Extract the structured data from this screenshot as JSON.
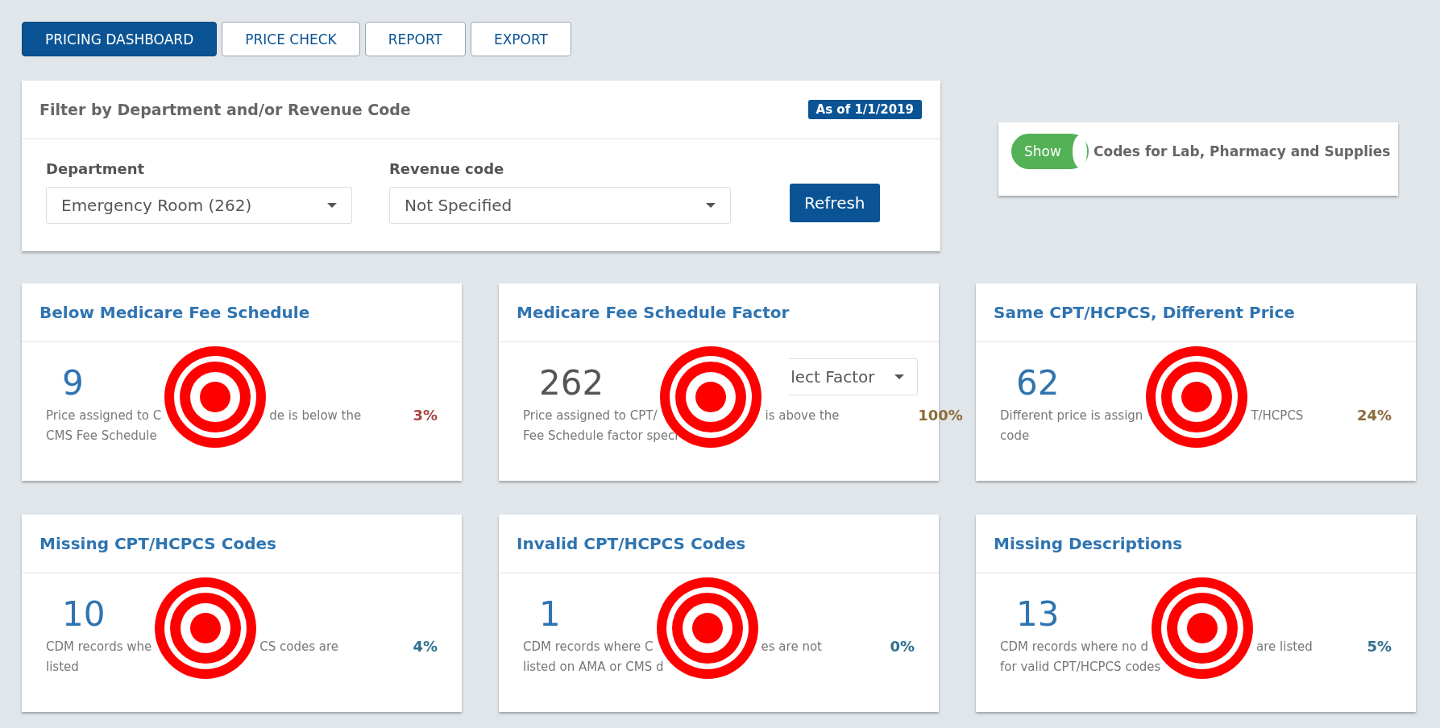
{
  "tabs": [
    {
      "label": "PRICING DASHBOARD",
      "selected": true
    },
    {
      "label": "PRICE CHECK",
      "selected": false
    },
    {
      "label": "REPORT",
      "selected": false
    },
    {
      "label": "EXPORT",
      "selected": false
    }
  ],
  "filter": {
    "title": "Filter by Department and/or Revenue Code",
    "badge": "As of 1/1/2019",
    "fields": [
      {
        "label": "Department",
        "value": "Emergency Room (262)"
      },
      {
        "label": "Revenue code",
        "value": "Not Specified"
      }
    ],
    "button": "Refresh"
  },
  "toggle": {
    "on": true,
    "label": "Show",
    "text": "Codes for Lab, Pharmacy and Supplies"
  },
  "cards": [
    {
      "kind": "count",
      "title": "Below Medicare Fee Schedule",
      "number": "9",
      "lines": [
        [
          "Price assigned to C",
          "de is below the"
        ],
        [
          "CMS Fee Schedule"
        ]
      ],
      "percent": "3%",
      "color": "#a94442"
    },
    {
      "kind": "factor",
      "title": "Medicare Fee Schedule Factor",
      "number": "262",
      "select": "lect Factor",
      "lines": [
        [
          "Price assigned to CPT/",
          "is above the"
        ],
        [
          "Fee Schedule factor speci"
        ]
      ],
      "percent": "100%",
      "color": "#8a6d3b"
    },
    {
      "kind": "count",
      "title": "Same CPT/HCPCS, Different Price",
      "number": "62",
      "lines": [
        [
          "Different price is assign",
          "T/HCPCS"
        ],
        [
          "code"
        ]
      ],
      "percent": "24%",
      "color": "#8a6d3b"
    },
    {
      "kind": "count",
      "title": "Missing CPT/HCPCS Codes",
      "number": "10",
      "lines": [
        [
          "CDM records whe",
          "CS codes are"
        ],
        [
          "listed"
        ]
      ],
      "percent": "4%",
      "color": "#31708f"
    },
    {
      "kind": "count",
      "title": "Invalid CPT/HCPCS Codes",
      "number": "1",
      "lines": [
        [
          "CDM records where C",
          "es are not"
        ],
        [
          "listed on AMA or CMS d"
        ]
      ],
      "percent": "0%",
      "color": "#31708f"
    },
    {
      "kind": "count",
      "title": "Missing Descriptions",
      "number": "13",
      "lines": [
        [
          "CDM records where no d",
          "are listed"
        ],
        [
          "for valid CPT/HCPCS codes"
        ]
      ],
      "percent": "5%",
      "color": "#31708f"
    }
  ]
}
